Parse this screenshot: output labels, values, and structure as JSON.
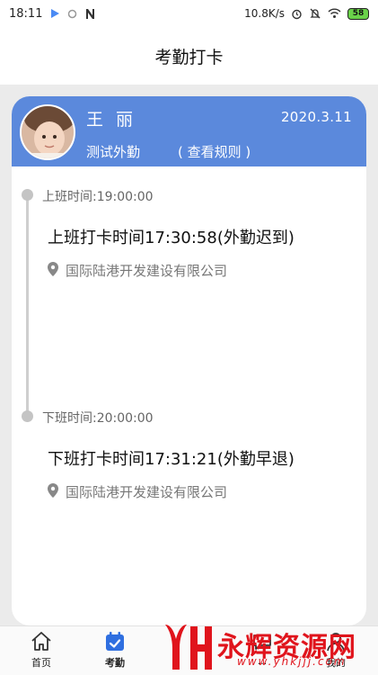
{
  "status": {
    "time": "18:11",
    "speed": "10.8K/s",
    "battery": "58"
  },
  "page": {
    "title": "考勤打卡"
  },
  "header": {
    "user_name": "王丽",
    "date": "2020.3.11",
    "group": "测试外勤",
    "rules_link": "( 查看规则 )"
  },
  "records": [
    {
      "shift_label": "上班时间:19:00:00",
      "punch": "上班打卡时间17:30:58(外勤迟到)",
      "location": "国际陆港开发建设有限公司"
    },
    {
      "shift_label": "下班时间:20:00:00",
      "punch": "下班打卡时间17:31:21(外勤早退)",
      "location": "国际陆港开发建设有限公司"
    }
  ],
  "tabs": [
    {
      "label": "首页",
      "icon": "home-icon"
    },
    {
      "label": "考勤",
      "icon": "calendar-check-icon",
      "active": true
    },
    {
      "label": "...",
      "icon": "chat-icon"
    },
    {
      "label": "我的",
      "icon": "user-icon"
    }
  ],
  "watermark": {
    "text": "永辉资源网",
    "sub": "www.yhkjjj.com"
  },
  "colors": {
    "accent": "#5b89dc",
    "watermark": "#e0141c"
  }
}
